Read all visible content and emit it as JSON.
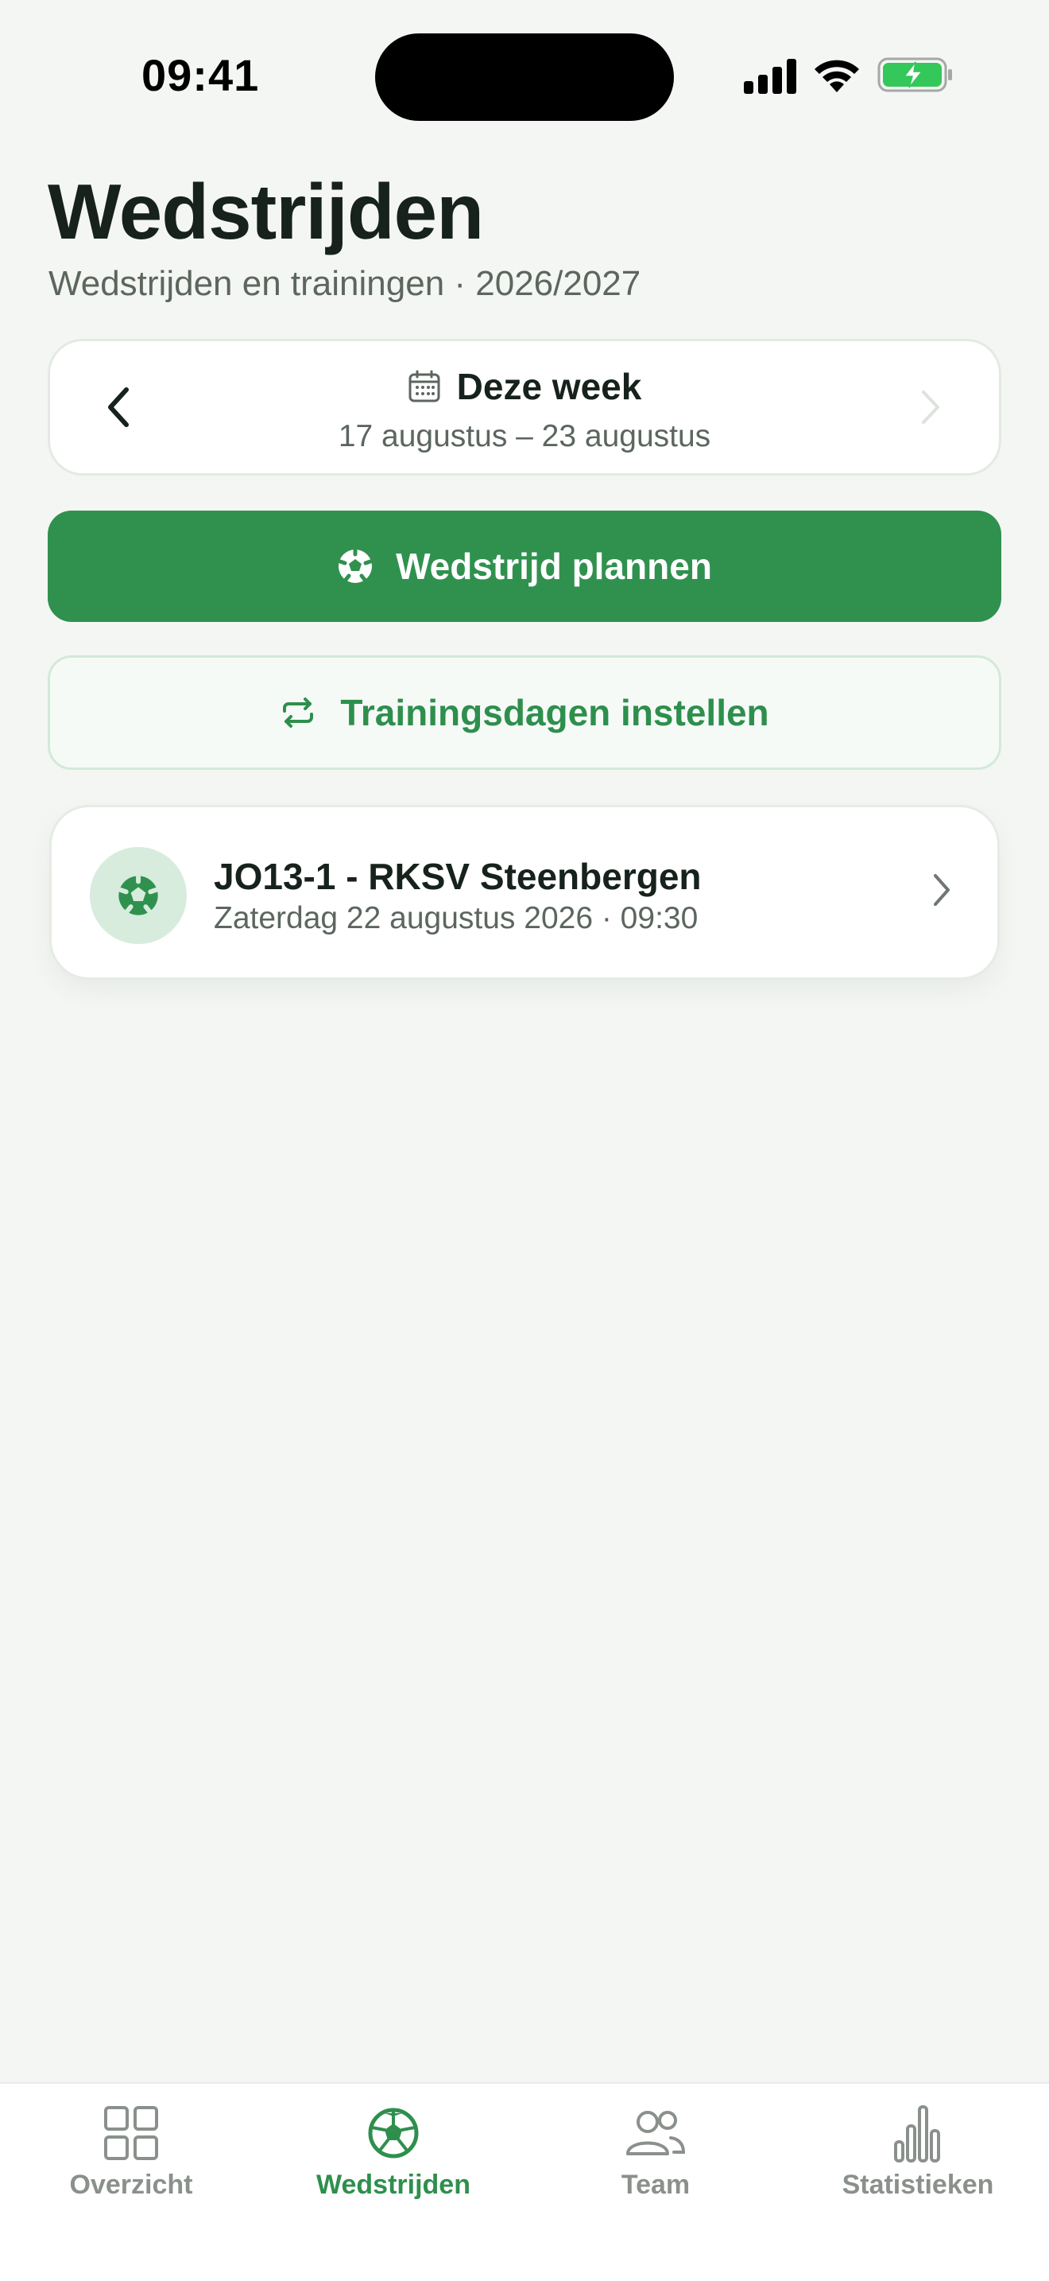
{
  "status_bar": {
    "time": "09:41"
  },
  "header": {
    "title": "Wedstrijden",
    "subtitle": "Wedstrijden en trainingen · 2026/2027"
  },
  "week_selector": {
    "title": "Deze week",
    "range": "17 augustus – 23 augustus",
    "calendar_icon": "calendar-icon",
    "prev_icon": "chevron-left-icon",
    "next_icon": "chevron-right-icon"
  },
  "actions": {
    "plan_label": "Wedstrijd plannen",
    "plan_icon": "soccer-ball-icon",
    "training_label": "Trainingsdagen instellen",
    "training_icon": "repeat-icon"
  },
  "matches": [
    {
      "title": "JO13-1 - RKSV Steenbergen",
      "meta": "Zaterdag 22 augustus 2026 · 09:30",
      "icon": "soccer-ball-icon"
    }
  ],
  "tabs": [
    {
      "label": "Overzicht",
      "icon": "grid-icon",
      "active": false
    },
    {
      "label": "Wedstrijden",
      "icon": "soccer-ball-icon",
      "active": true
    },
    {
      "label": "Team",
      "icon": "users-icon",
      "active": false
    },
    {
      "label": "Statistieken",
      "icon": "bar-chart-icon",
      "active": false
    }
  ],
  "colors": {
    "accent": "#30914f",
    "accent_text": "#2e8f4d",
    "background": "#f4f6f3",
    "muted_text": "#5c665f",
    "inactive_tab": "#8a908b",
    "battery_fill": "#34c759"
  }
}
